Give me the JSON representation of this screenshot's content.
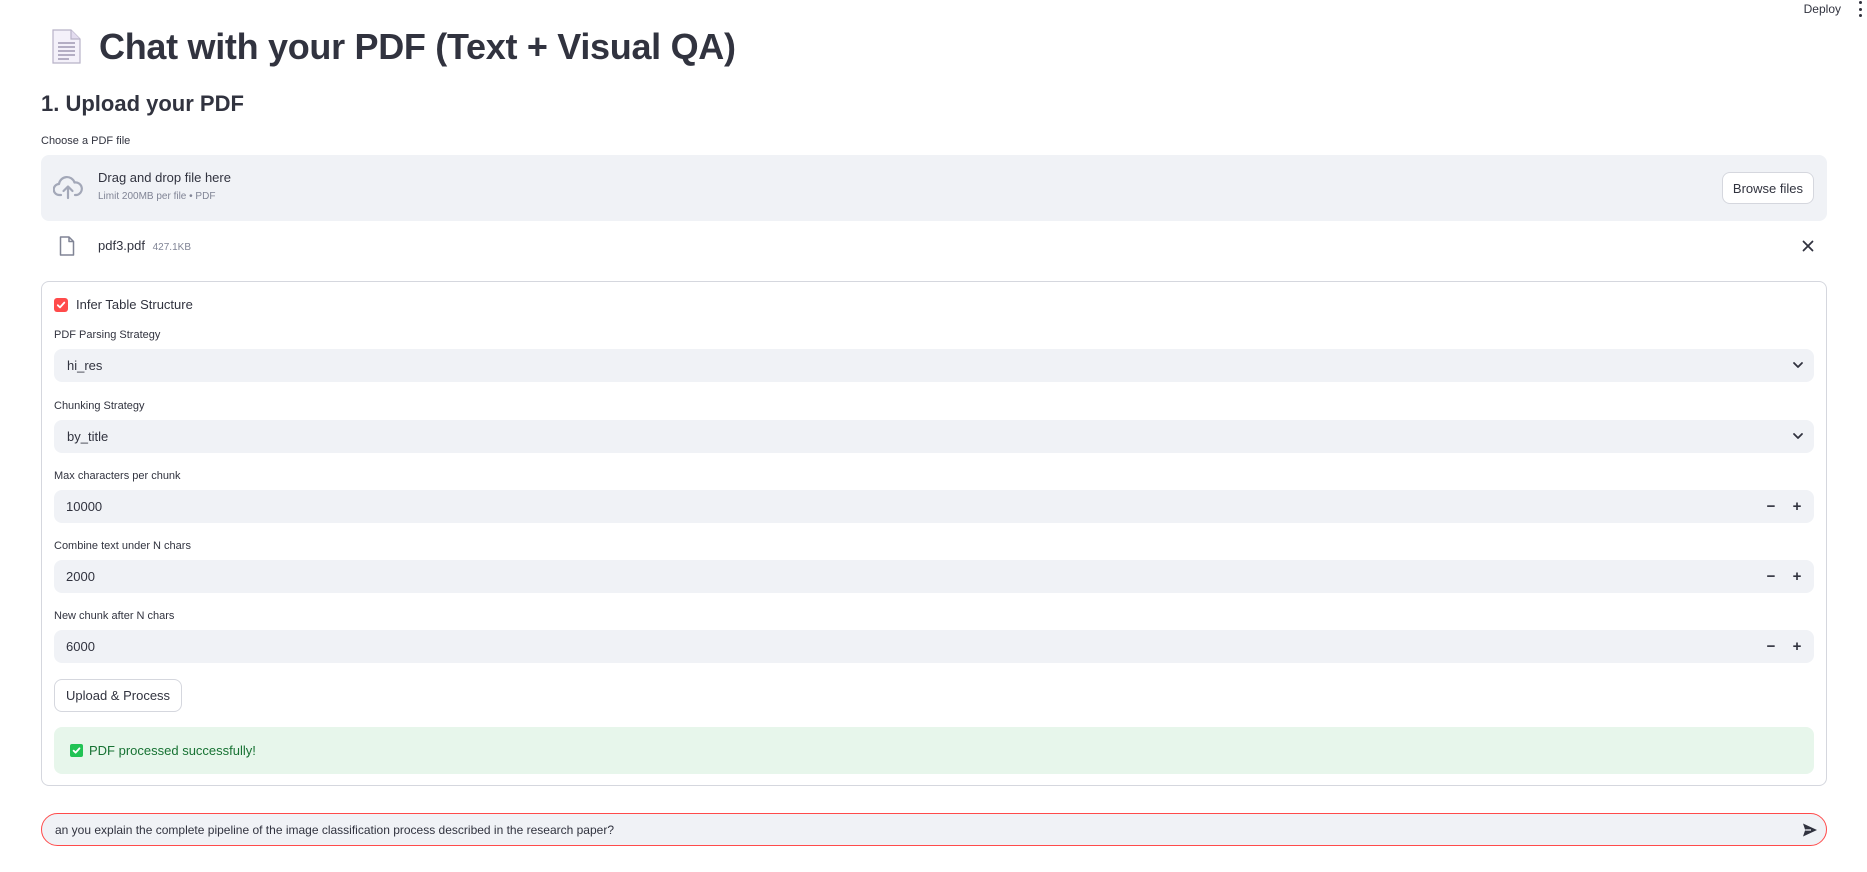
{
  "header": {
    "deploy_label": "Deploy",
    "menu_icon": "kebab-menu-icon"
  },
  "page": {
    "title": "Chat with your PDF (Text + Visual QA)",
    "title_icon": "document-icon"
  },
  "upload_section": {
    "heading": "1. Upload your PDF",
    "uploader_label": "Choose a PDF file",
    "dropzone_text": "Drag and drop file here",
    "dropzone_hint": "Limit 200MB per file • PDF",
    "browse_label": "Browse files",
    "file": {
      "name": "pdf3.pdf",
      "size": "427.1KB"
    }
  },
  "options": {
    "infer_table": {
      "label": "Infer Table Structure",
      "checked": true
    },
    "parsing_strategy": {
      "label": "PDF Parsing Strategy",
      "value": "hi_res"
    },
    "chunking_strategy": {
      "label": "Chunking Strategy",
      "value": "by_title"
    },
    "max_chars": {
      "label": "Max characters per chunk",
      "value": "10000"
    },
    "combine_under": {
      "label": "Combine text under N chars",
      "value": "2000"
    },
    "new_after": {
      "label": "New chunk after N chars",
      "value": "6000"
    },
    "stepper_minus": "−",
    "stepper_plus": "+",
    "submit_label": "Upload & Process",
    "success_message": "PDF processed successfully!"
  },
  "chat": {
    "input_value": "an you explain the complete pipeline of the image classification process described in the research paper?"
  },
  "colors": {
    "accent": "#ff4b4b",
    "input_bg": "#f0f2f6",
    "success_bg": "#e7f6eb",
    "success_text": "#177233",
    "success_icon": "#21c354"
  }
}
